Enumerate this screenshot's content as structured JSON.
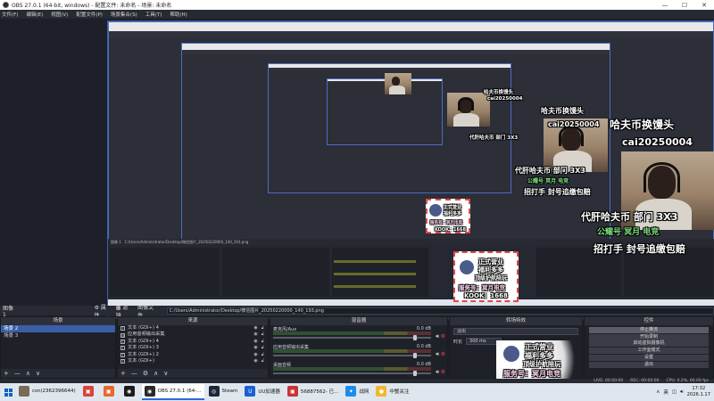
{
  "window": {
    "title": "OBS 27.0.1 (64-bit, windows) - 配置文件: 未命名 - 场景: 未命名",
    "controls": [
      "—",
      "☐",
      "✕"
    ]
  },
  "menu": [
    "文件(F)",
    "编辑(E)",
    "视图(V)",
    "配置文件(P)",
    "场景集合(S)",
    "工具(T)",
    "帮助(H)"
  ],
  "overlay": {
    "title": "哈夫币换馒头",
    "id": "cai20250004",
    "line1": "代肝哈夫币 部门 3X3",
    "line2": "公耀号 冥月 电竞",
    "line3": "招打手 封号追缴包赔",
    "badge": {
      "l1": "正式营业",
      "l2": "福利多多",
      "l3": "顶级护航陪玩",
      "l4": "服务号：冥月电竞",
      "l5": "KOOK：1668"
    }
  },
  "pathbar": {
    "label": "图像 1",
    "settings": "属性",
    "filters": "滤镜",
    "image_file": "图像文件",
    "path": "C:/Users/Administrator/Desktop/微信图片_20250220000_140_193.png"
  },
  "docks": {
    "scenes": {
      "title": "场景",
      "items": [
        "场景 2",
        "场景 3"
      ],
      "footer": [
        "+",
        "—",
        "∧",
        "∨"
      ]
    },
    "sources": {
      "title": "来源",
      "items": [
        {
          "icon": "T",
          "label": "文本 (GDI+) 4"
        },
        {
          "icon": "⊟",
          "label": "应用音频输出采集"
        },
        {
          "icon": "T",
          "label": "文本 (GDI+) 4"
        },
        {
          "icon": "T",
          "label": "文本 (GDI+) 3"
        },
        {
          "icon": "T",
          "label": "文本 (GDI+) 2"
        },
        {
          "icon": "T",
          "label": "文本 (GDI+)"
        }
      ],
      "footer": [
        "+",
        "—",
        "⚙",
        "∧",
        "∨"
      ]
    },
    "mixer": {
      "title": "混音器",
      "channels": [
        {
          "name": "麦克风/Aux",
          "db": "0.0 dB",
          "level": 0.9
        },
        {
          "name": "应用音频输出采集",
          "db": "0.0 dB",
          "level": 0.9
        },
        {
          "name": "桌面音频",
          "db": "0.0 dB",
          "level": 0.9
        }
      ]
    },
    "transitions": {
      "title": "转场特效",
      "type": "淡出",
      "duration_label": "时长",
      "duration": "300 ms"
    },
    "controls": {
      "title": "控件",
      "buttons": [
        "停止推流",
        "开始录制",
        "启动虚拟摄像机",
        "工作室模式",
        "设置",
        "退出"
      ]
    }
  },
  "status": {
    "live": "LIVE: 00:00:00",
    "rec": "REC: 00:00:00",
    "cpu": "CPU: 0.2%, 60.00 fps"
  },
  "taskbar": {
    "items": [
      {
        "label": "csn(2362396644)",
        "color": "#7a6a58",
        "icon": ""
      },
      {
        "label": "",
        "color": "#d9433a",
        "icon": "▣"
      },
      {
        "label": "",
        "color": "#e8672c",
        "icon": "▣"
      },
      {
        "label": "",
        "color": "#1c1c1c",
        "icon": "◉"
      },
      {
        "label": "OBS 27.0.1 (64-...",
        "color": "#2b2b2b",
        "icon": "◉"
      },
      {
        "label": "Steam",
        "color": "#1b2838",
        "icon": "◎"
      },
      {
        "label": "UU加速器",
        "color": "#1d5fd1",
        "icon": "U"
      },
      {
        "label": "56887562- 已...",
        "color": "#c83333",
        "icon": "▣"
      },
      {
        "label": "战网",
        "color": "#1c8ce8",
        "icon": "✦"
      },
      {
        "label": "中蟹关注",
        "color": "#f2b82b",
        "icon": "●"
      }
    ],
    "tray_lang": "英",
    "time": "17:32",
    "date": "2026.1.17"
  }
}
